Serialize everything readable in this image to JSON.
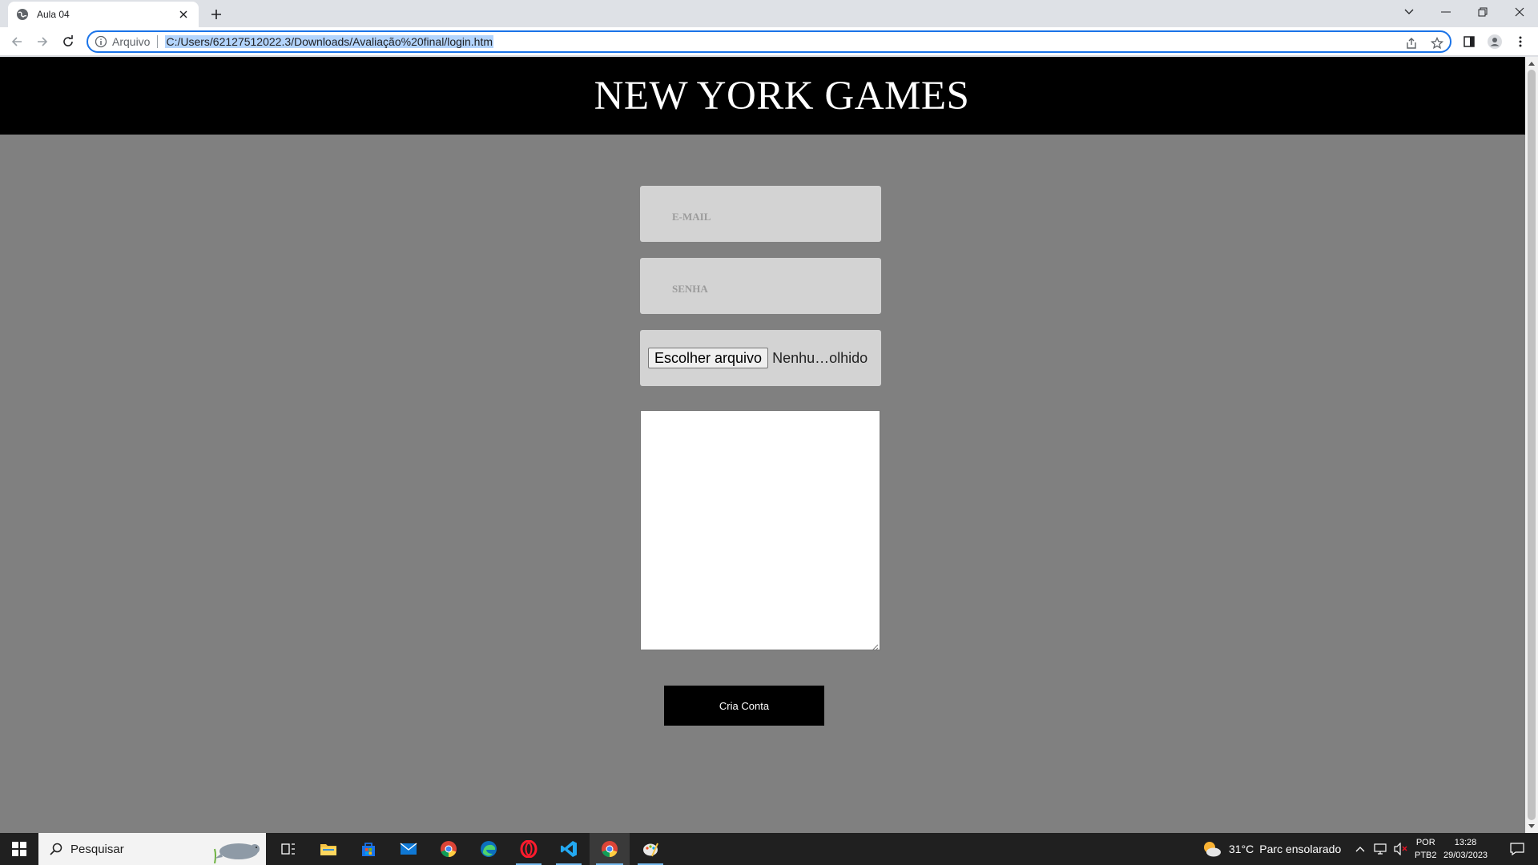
{
  "browser": {
    "tab_title": "Aula 04",
    "omnibox": {
      "scheme": "Arquivo",
      "url": "C:/Users/62127512022.3/Downloads/Avaliação%20final/login.htm"
    }
  },
  "page": {
    "header_title": "NEW YORK GAMES",
    "form": {
      "email_placeholder": "E-MAIL",
      "senha_placeholder": "SENHA",
      "file_button": "Escolher arquivo",
      "file_status": "Nenhu…olhido",
      "submit_label": "Cria Conta"
    }
  },
  "taskbar": {
    "search_placeholder": "Pesquisar",
    "weather_temp": "31°C",
    "weather_desc": "Parc ensolarado",
    "lang_top": "POR",
    "lang_bottom": "PTB2",
    "time": "13:28",
    "date": "29/03/2023"
  },
  "colors": {
    "page_background": "#808080",
    "header_background": "#000000",
    "input_background": "#d3d3d3",
    "button_background": "#000000",
    "omnibox_focus": "#1a73e8"
  },
  "icons": [
    "globe-icon",
    "close-icon",
    "plus-icon",
    "chevron-down-icon",
    "minimize-icon",
    "restore-icon",
    "window-close-icon",
    "back-arrow-icon",
    "forward-arrow-icon",
    "reload-icon",
    "info-icon",
    "share-icon",
    "star-icon",
    "side-panel-icon",
    "profile-icon",
    "menu-dots-icon",
    "windows-start-icon",
    "search-icon",
    "task-view-icon",
    "file-explorer-icon",
    "store-icon",
    "mail-icon",
    "chrome-icon",
    "edge-icon",
    "opera-icon",
    "vscode-icon",
    "paint-icon",
    "weather-icon",
    "chevron-up-icon",
    "network-icon",
    "speaker-icon",
    "notification-icon"
  ]
}
